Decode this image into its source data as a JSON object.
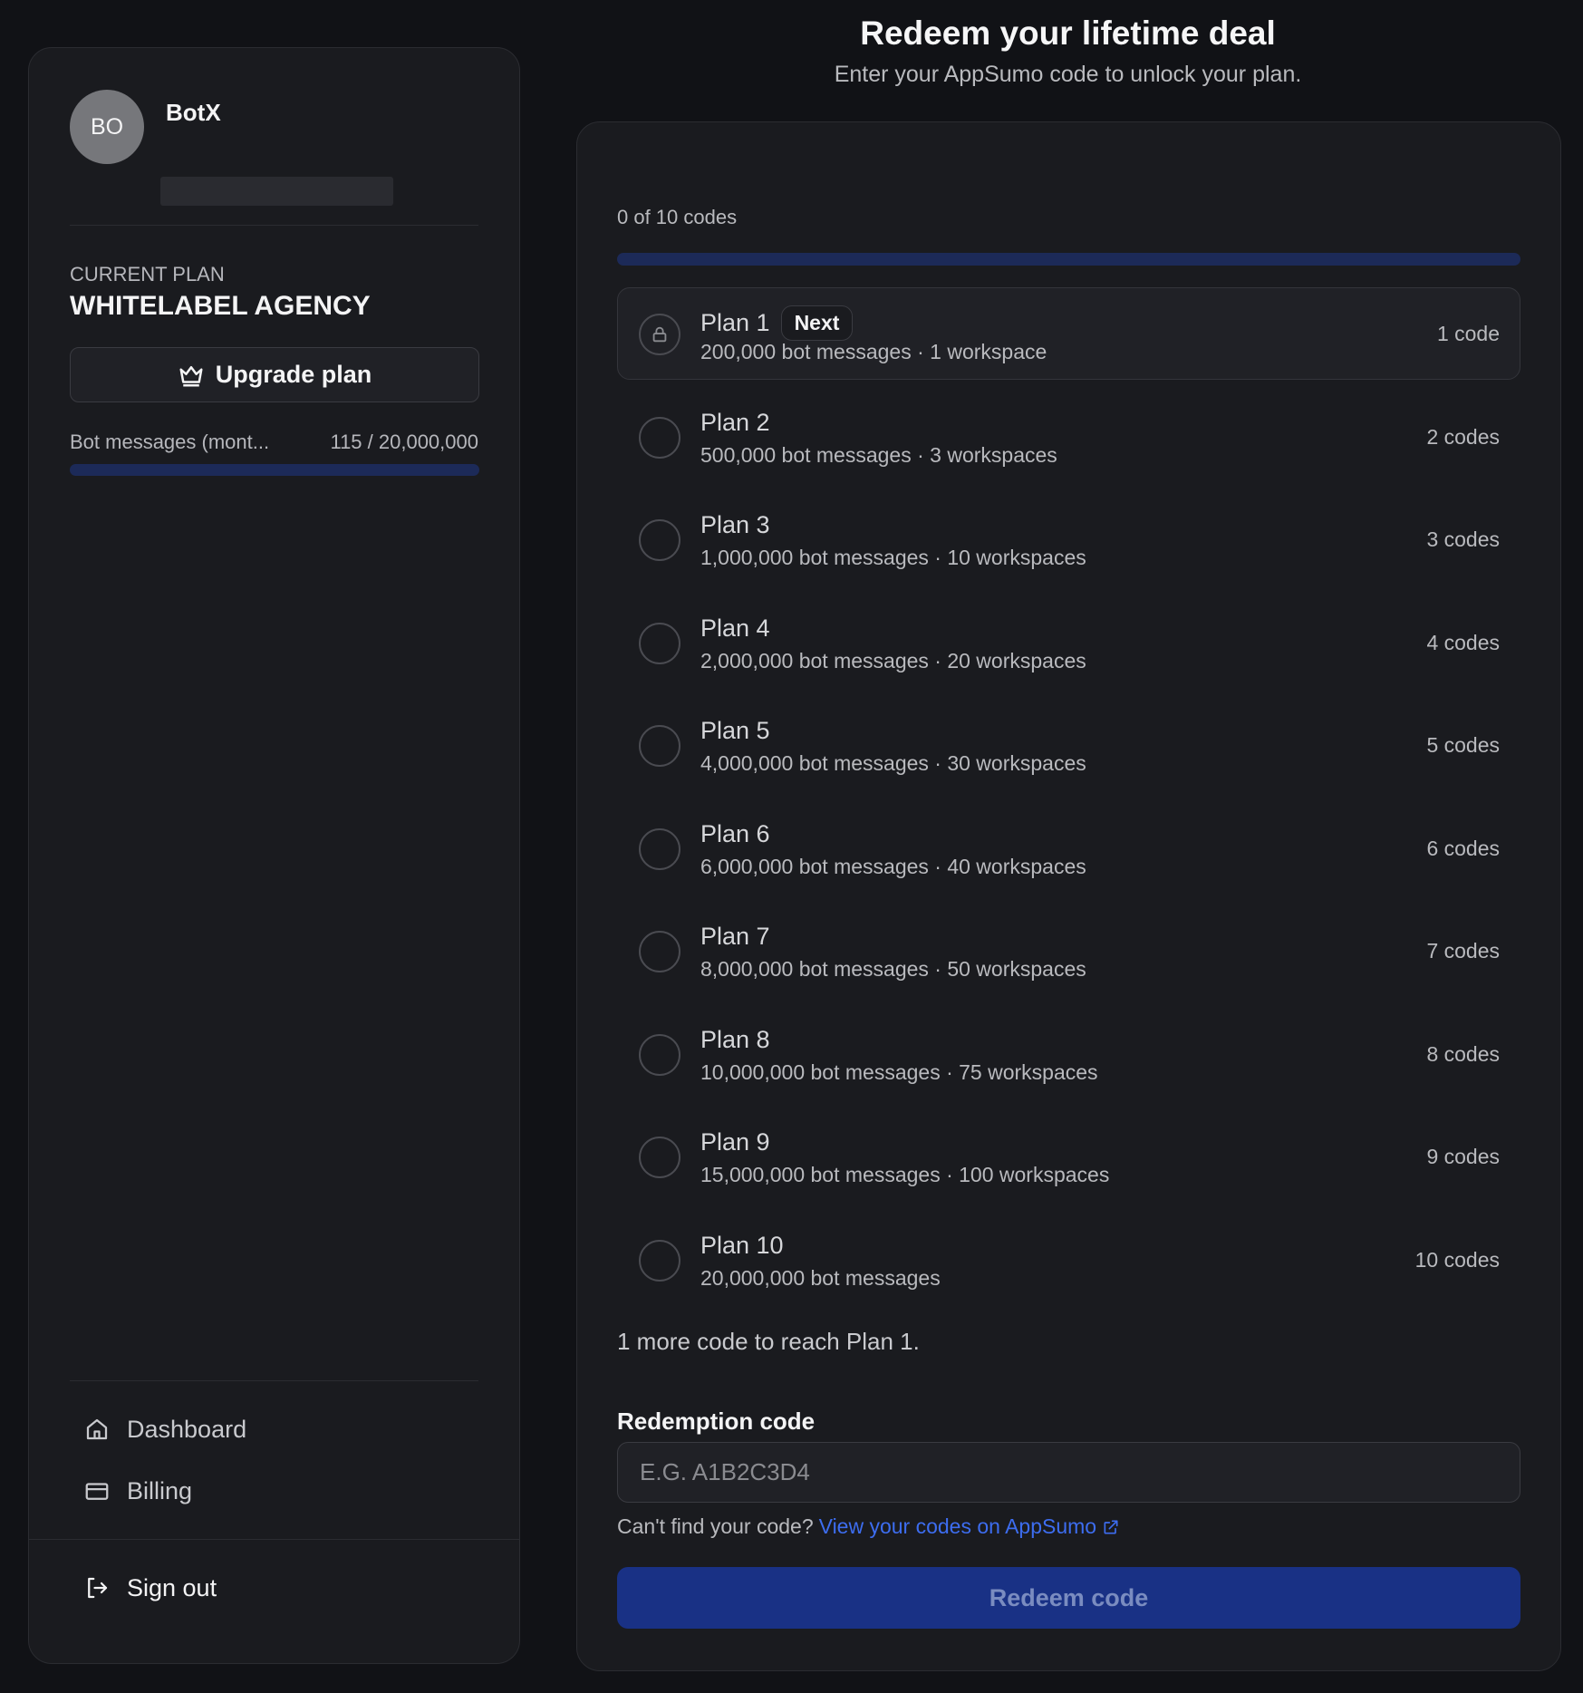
{
  "sidebar": {
    "avatar_initials": "BO",
    "profile_name": "BotX",
    "plan_caption": "CURRENT PLAN",
    "plan_name": "WHITELABEL AGENCY",
    "upgrade_label": "Upgrade plan",
    "usage": {
      "label": "Bot messages (mont...",
      "value": "115 / 20,000,000",
      "fraction": 5.75e-06
    },
    "nav": [
      {
        "label": "Dashboard",
        "icon": "home-icon"
      },
      {
        "label": "Billing",
        "icon": "credit-card-icon"
      }
    ],
    "signout_label": "Sign out"
  },
  "main": {
    "title": "Redeem your lifetime deal",
    "subtitle": "Enter your AppSumo code to unlock your plan.",
    "codes_count": "0 of 10 codes",
    "codes_fraction": 0,
    "plans": [
      {
        "name": "Plan 1",
        "badge": "Next",
        "desc": "200,000 bot messages · 1 workspace",
        "codes": "1 code",
        "locked": true
      },
      {
        "name": "Plan 2",
        "badge": "",
        "desc": "500,000 bot messages · 3 workspaces",
        "codes": "2 codes",
        "locked": false
      },
      {
        "name": "Plan 3",
        "badge": "",
        "desc": "1,000,000 bot messages · 10 workspaces",
        "codes": "3 codes",
        "locked": false
      },
      {
        "name": "Plan 4",
        "badge": "",
        "desc": "2,000,000 bot messages · 20 workspaces",
        "codes": "4 codes",
        "locked": false
      },
      {
        "name": "Plan 5",
        "badge": "",
        "desc": "4,000,000 bot messages · 30 workspaces",
        "codes": "5 codes",
        "locked": false
      },
      {
        "name": "Plan 6",
        "badge": "",
        "desc": "6,000,000 bot messages · 40 workspaces",
        "codes": "6 codes",
        "locked": false
      },
      {
        "name": "Plan 7",
        "badge": "",
        "desc": "8,000,000 bot messages · 50 workspaces",
        "codes": "7 codes",
        "locked": false
      },
      {
        "name": "Plan 8",
        "badge": "",
        "desc": "10,000,000 bot messages · 75 workspaces",
        "codes": "8 codes",
        "locked": false
      },
      {
        "name": "Plan 9",
        "badge": "",
        "desc": "15,000,000 bot messages · 100 workspaces",
        "codes": "9 codes",
        "locked": false
      },
      {
        "name": "Plan 10",
        "badge": "",
        "desc": "20,000,000 bot messages",
        "codes": "10 codes",
        "locked": false
      }
    ],
    "hint": "1 more code to reach Plan 1.",
    "field_label": "Redemption code",
    "input_placeholder": "E.G. A1B2C3D4",
    "input_value": "",
    "help_text": "Can't find your code?",
    "help_link": "View your codes on AppSumo",
    "redeem_label": "Redeem code"
  },
  "colors": {
    "background": "#111216",
    "panel": "#1a1b1f",
    "accent": "#193185",
    "link": "#3d6df0",
    "progress_track": "#1c2a58"
  }
}
